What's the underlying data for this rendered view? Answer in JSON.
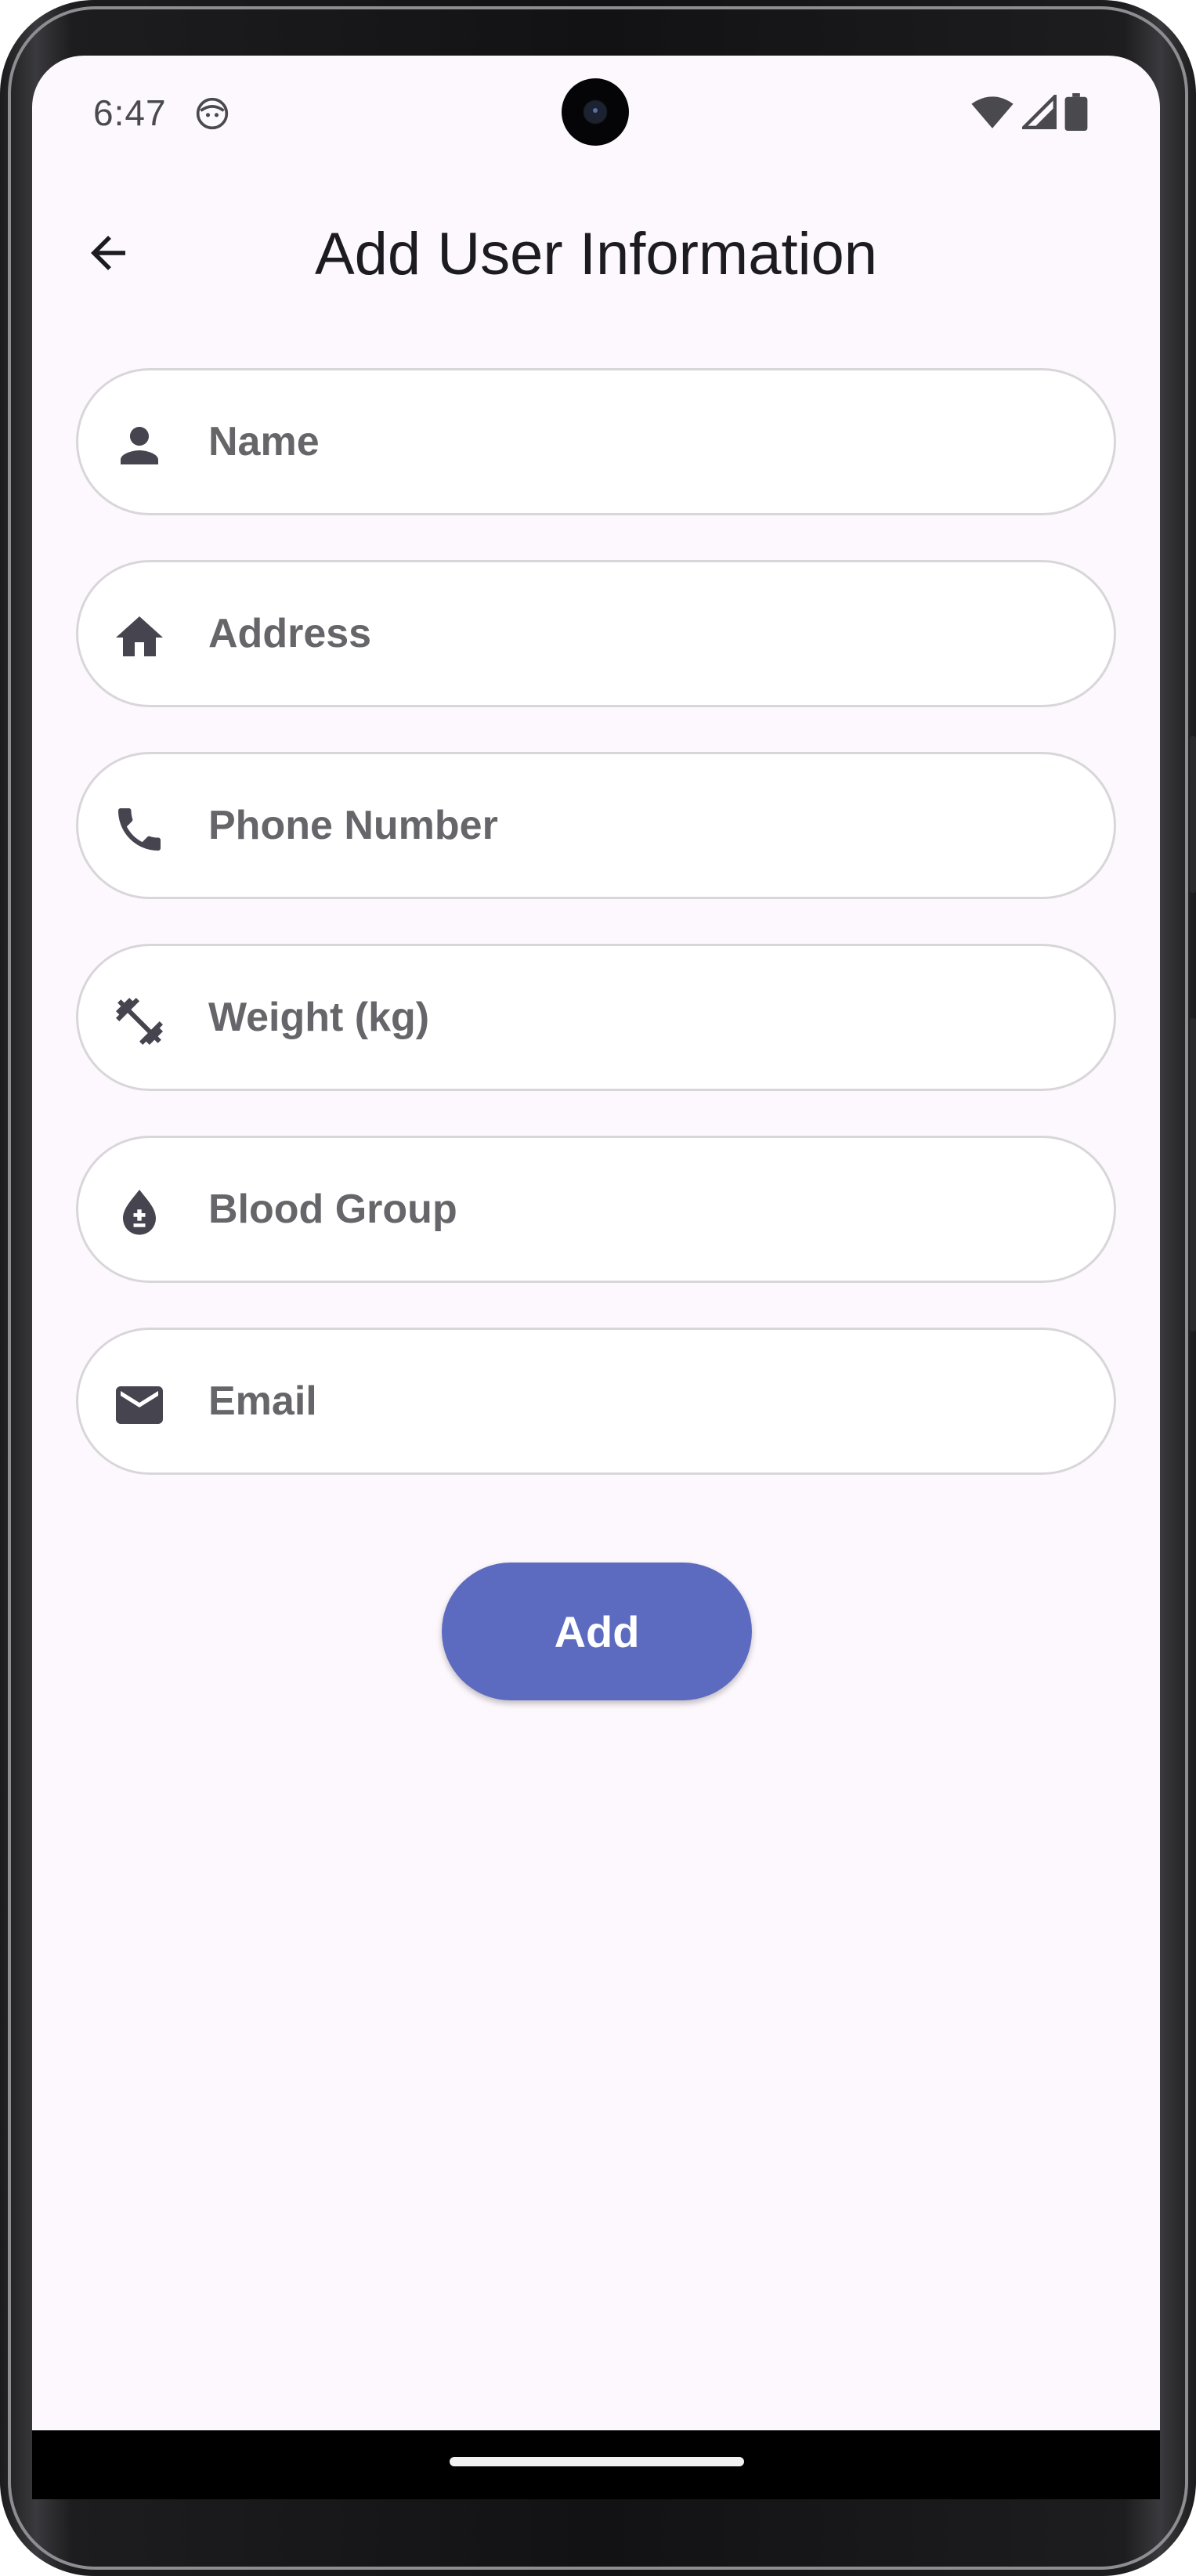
{
  "status_bar": {
    "time": "6:47",
    "app_icon": "android-face-icon",
    "icons": [
      "wifi-icon",
      "cellular-signal-icon",
      "battery-icon"
    ]
  },
  "app_bar": {
    "title": "Add User Information",
    "back_icon": "arrow-back-icon"
  },
  "form": {
    "fields": [
      {
        "placeholder": "Name",
        "value": "",
        "icon": "person-icon"
      },
      {
        "placeholder": "Address",
        "value": "",
        "icon": "home-icon"
      },
      {
        "placeholder": "Phone Number",
        "value": "",
        "icon": "phone-icon"
      },
      {
        "placeholder": "Weight (kg)",
        "value": "",
        "icon": "fitness-dumbbell-icon"
      },
      {
        "placeholder": "Blood Group",
        "value": "",
        "icon": "blood-drop-icon"
      },
      {
        "placeholder": "Email",
        "value": "",
        "icon": "email-icon"
      }
    ],
    "submit_label": "Add"
  },
  "colors": {
    "background": "#fdf8fd",
    "field_border": "#d9d6da",
    "placeholder_text": "#66656a",
    "icon": "#46454f",
    "button": "#5c6bc0",
    "button_text": "#ffffff"
  }
}
